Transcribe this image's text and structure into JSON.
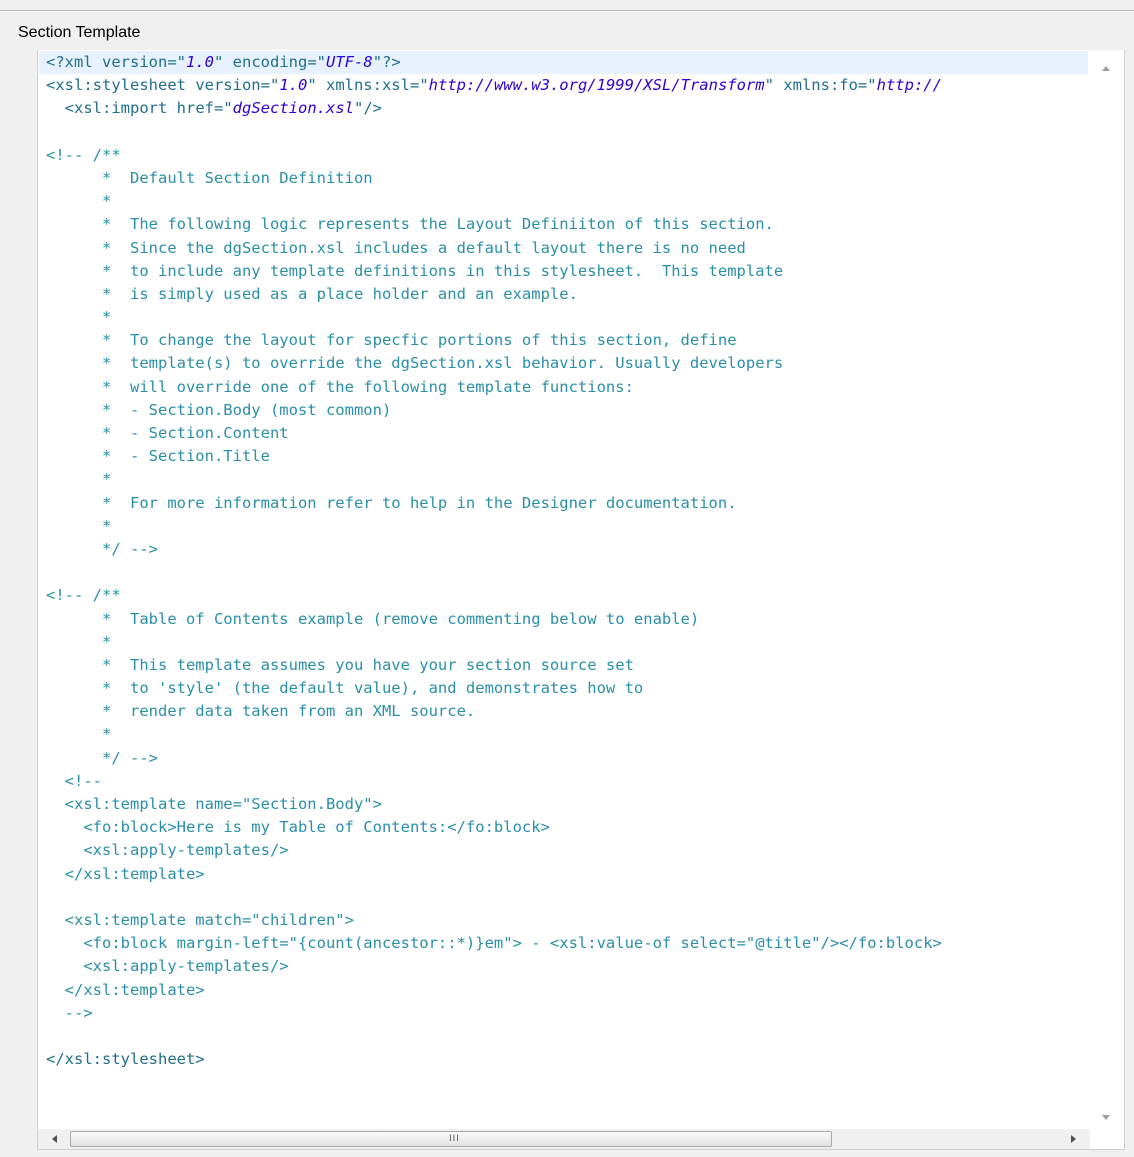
{
  "panel": {
    "title": "Section Template"
  },
  "scroll": {
    "thumb_grip": "III"
  },
  "icons": {
    "up": "scroll-up-arrow",
    "down": "scroll-down-arrow",
    "left": "scroll-left-arrow",
    "right": "scroll-right-arrow"
  },
  "colors": {
    "tag": "#1f6f8b",
    "value": "#2e00d6",
    "comment": "#2a8fa8",
    "current_line": "#e8f2fe"
  },
  "code_lines": [
    [
      [
        "tag",
        "<?xml "
      ],
      [
        "attr",
        "version="
      ],
      [
        "tag",
        "\""
      ],
      [
        "val",
        "1.0"
      ],
      [
        "tag",
        "\" "
      ],
      [
        "attr",
        "encoding="
      ],
      [
        "tag",
        "\""
      ],
      [
        "val",
        "UTF-8"
      ],
      [
        "tag",
        "\"?>"
      ]
    ],
    [
      [
        "tag",
        "<xsl:stylesheet "
      ],
      [
        "attr",
        "version="
      ],
      [
        "tag",
        "\""
      ],
      [
        "val",
        "1.0"
      ],
      [
        "tag",
        "\" "
      ],
      [
        "attr",
        "xmlns:xsl="
      ],
      [
        "tag",
        "\""
      ],
      [
        "val",
        "http://www.w3.org/1999/XSL/Transform"
      ],
      [
        "tag",
        "\" "
      ],
      [
        "attr",
        "xmlns:fo="
      ],
      [
        "tag",
        "\""
      ],
      [
        "val",
        "http://"
      ]
    ],
    [
      [
        "tag",
        "  <xsl:import "
      ],
      [
        "attr",
        "href="
      ],
      [
        "tag",
        "\""
      ],
      [
        "val",
        "dgSection.xsl"
      ],
      [
        "tag",
        "\"/>"
      ]
    ],
    [],
    [
      [
        "comment",
        "<!-- /**"
      ]
    ],
    [
      [
        "comment",
        "      *  Default Section Definition"
      ]
    ],
    [
      [
        "comment",
        "      *"
      ]
    ],
    [
      [
        "comment",
        "      *  The following logic represents the Layout Definiiton of this section."
      ]
    ],
    [
      [
        "comment",
        "      *  Since the dgSection.xsl includes a default layout there is no need"
      ]
    ],
    [
      [
        "comment",
        "      *  to include any template definitions in this stylesheet.  This template"
      ]
    ],
    [
      [
        "comment",
        "      *  is simply used as a place holder and an example."
      ]
    ],
    [
      [
        "comment",
        "      *"
      ]
    ],
    [
      [
        "comment",
        "      *  To change the layout for specfic portions of this section, define"
      ]
    ],
    [
      [
        "comment",
        "      *  template(s) to override the dgSection.xsl behavior. Usually developers"
      ]
    ],
    [
      [
        "comment",
        "      *  will override one of the following template functions:"
      ]
    ],
    [
      [
        "comment",
        "      *  - Section.Body (most common)"
      ]
    ],
    [
      [
        "comment",
        "      *  - Section.Content"
      ]
    ],
    [
      [
        "comment",
        "      *  - Section.Title"
      ]
    ],
    [
      [
        "comment",
        "      *"
      ]
    ],
    [
      [
        "comment",
        "      *  For more information refer to help in the Designer documentation."
      ]
    ],
    [
      [
        "comment",
        "      *"
      ]
    ],
    [
      [
        "comment",
        "      */ -->"
      ]
    ],
    [],
    [
      [
        "comment",
        "<!-- /**"
      ]
    ],
    [
      [
        "comment",
        "      *  Table of Contents example (remove commenting below to enable)"
      ]
    ],
    [
      [
        "comment",
        "      *"
      ]
    ],
    [
      [
        "comment",
        "      *  This template assumes you have your section source set"
      ]
    ],
    [
      [
        "comment",
        "      *  to 'style' (the default value), and demonstrates how to"
      ]
    ],
    [
      [
        "comment",
        "      *  render data taken from an XML source."
      ]
    ],
    [
      [
        "comment",
        "      *"
      ]
    ],
    [
      [
        "comment",
        "      */ -->"
      ]
    ],
    [
      [
        "comment",
        "  <!--"
      ]
    ],
    [
      [
        "comment",
        "  <xsl:template name=\"Section.Body\">"
      ]
    ],
    [
      [
        "comment",
        "    <fo:block>Here is my Table of Contents:</fo:block>"
      ]
    ],
    [
      [
        "comment",
        "    <xsl:apply-templates/>"
      ]
    ],
    [
      [
        "comment",
        "  </xsl:template>"
      ]
    ],
    [],
    [
      [
        "comment",
        "  <xsl:template match=\"children\">"
      ]
    ],
    [
      [
        "comment",
        "    <fo:block margin-left=\"{count(ancestor::*)}em\"> - <xsl:value-of select=\"@title\"/></fo:block>"
      ]
    ],
    [
      [
        "comment",
        "    <xsl:apply-templates/>"
      ]
    ],
    [
      [
        "comment",
        "  </xsl:template>"
      ]
    ],
    [
      [
        "comment",
        "  -->"
      ]
    ],
    [],
    [
      [
        "tag",
        "</xsl:stylesheet>"
      ]
    ]
  ]
}
